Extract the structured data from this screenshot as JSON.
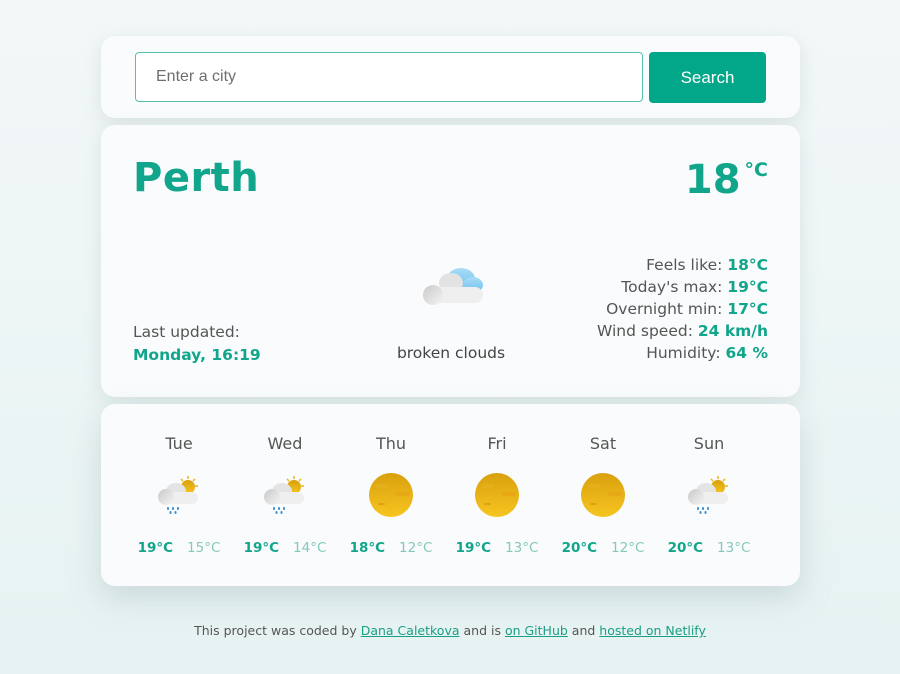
{
  "search": {
    "placeholder": "Enter a city",
    "value": "",
    "button_label": "Search"
  },
  "current": {
    "city": "Perth",
    "temperature": "18",
    "unit": "°C",
    "last_updated_label": "Last updated:",
    "last_updated_value": "Monday, 16:19",
    "icon": "broken-clouds-icon",
    "description": "broken clouds",
    "details": [
      {
        "label": "Feels like:",
        "value": "18°C"
      },
      {
        "label": "Today's max:",
        "value": "19°C"
      },
      {
        "label": "Overnight min:",
        "value": "17°C"
      },
      {
        "label": "Wind speed:",
        "value": "24 km/h"
      },
      {
        "label": "Humidity:",
        "value": "64 %"
      }
    ]
  },
  "forecast": [
    {
      "day": "Tue",
      "icon": "sun-cloud-rain-icon",
      "max": "19°C",
      "min": "15°C"
    },
    {
      "day": "Wed",
      "icon": "sun-cloud-rain-icon",
      "max": "19°C",
      "min": "14°C"
    },
    {
      "day": "Thu",
      "icon": "sun-icon",
      "max": "18°C",
      "min": "12°C"
    },
    {
      "day": "Fri",
      "icon": "sun-icon",
      "max": "19°C",
      "min": "13°C"
    },
    {
      "day": "Sat",
      "icon": "sun-icon",
      "max": "20°C",
      "min": "12°C"
    },
    {
      "day": "Sun",
      "icon": "sun-cloud-rain-icon",
      "max": "20°C",
      "min": "13°C"
    }
  ],
  "footer": {
    "text1": "This project was coded by ",
    "author_link": "Dana Caletkova",
    "text2": " and is ",
    "github_link": "on GitHub",
    "text3": " and ",
    "netlify_link": "hosted on Netlify"
  },
  "colors": {
    "accent": "#11a58b",
    "button": "#02a688"
  }
}
